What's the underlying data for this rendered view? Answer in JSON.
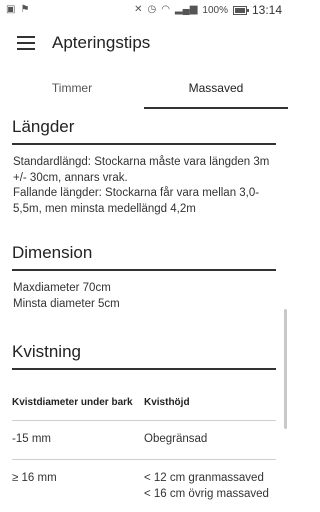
{
  "statusbar": {
    "left_icons": [
      "image-icon",
      "flag-icon"
    ],
    "battery": "100%",
    "time": "13:14"
  },
  "appbar": {
    "title": "Apteringstips"
  },
  "tabs": [
    {
      "label": "Timmer",
      "active": false
    },
    {
      "label": "Massaved",
      "active": true
    }
  ],
  "sections": {
    "langder": {
      "title": "Längder",
      "lines": [
        "Standardlängd: Stockarna måste vara längden 3m +/- 30cm, annars vrak.",
        "Fallande längder: Stockarna får vara mellan 3,0-5,5m, men minsta medellängd 4,2m"
      ]
    },
    "dimension": {
      "title": "Dimension",
      "lines": [
        "Maxdiameter 70cm",
        "Minsta diameter 5cm"
      ]
    },
    "kvistning": {
      "title": "Kvistning",
      "table": {
        "headers": [
          "Kvistdiameter under bark",
          "Kvisthöjd"
        ],
        "rows": [
          [
            "-15 mm",
            "Obegränsad"
          ],
          [
            "≥ 16 mm",
            "< 12 cm granmassaved\n< 16 cm övrig massaved"
          ]
        ]
      }
    }
  }
}
